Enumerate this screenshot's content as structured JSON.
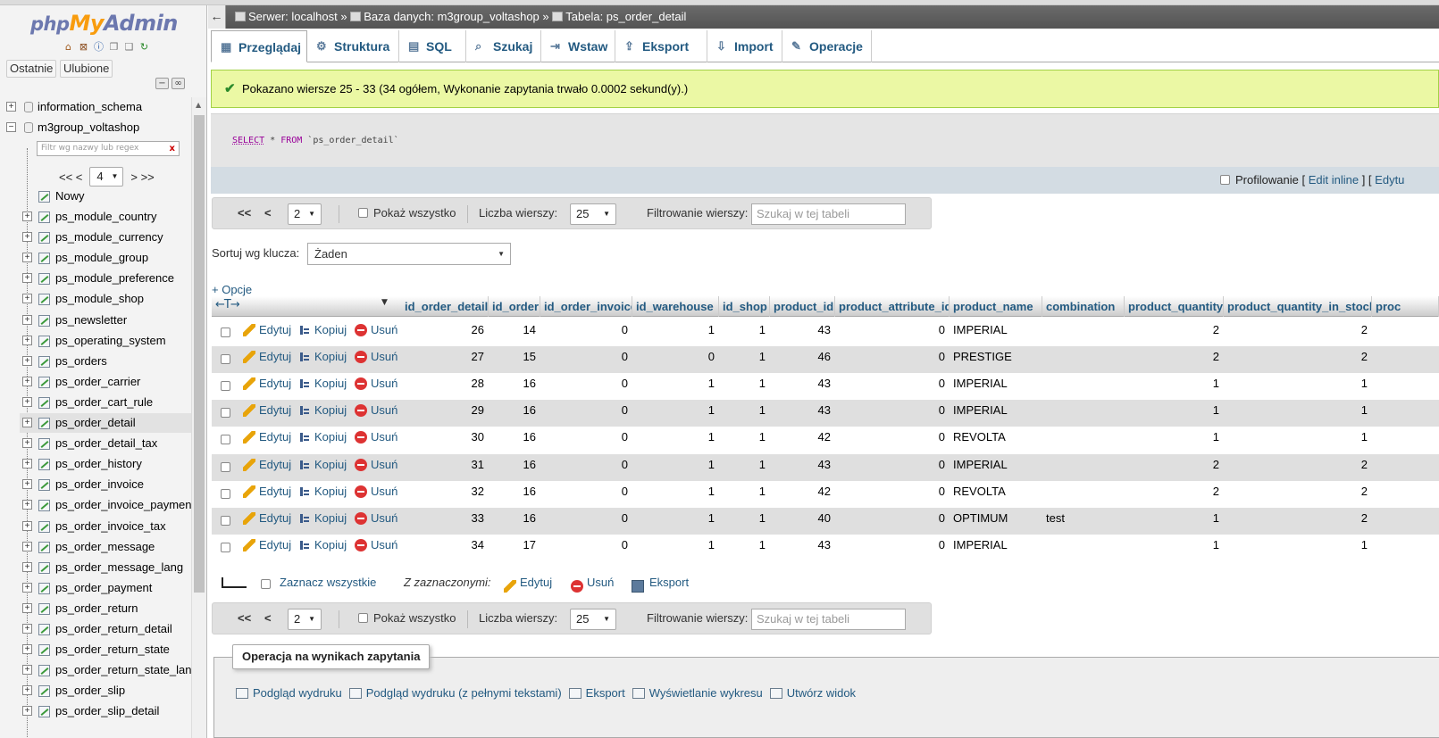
{
  "nav": {
    "logo_php": "php",
    "logo_my": "My",
    "logo_admin": "Admin",
    "recent_tab": "Ostatnie",
    "favorites_tab": "Ulubione",
    "filter_placeholder": "Filtr wg nazwy lub regex",
    "filter_clear": "x",
    "pager_first": "<< <",
    "pager_value": "4",
    "pager_next": "> >>",
    "databases": [
      {
        "name": "information_schema",
        "expander": "+"
      },
      {
        "name": "m3group_voltashop",
        "expander": "−"
      }
    ],
    "new_label": "Nowy",
    "tables": [
      "ps_module_country",
      "ps_module_currency",
      "ps_module_group",
      "ps_module_preference",
      "ps_module_shop",
      "ps_newsletter",
      "ps_operating_system",
      "ps_orders",
      "ps_order_carrier",
      "ps_order_cart_rule",
      "ps_order_detail",
      "ps_order_detail_tax",
      "ps_order_history",
      "ps_order_invoice",
      "ps_order_invoice_payment",
      "ps_order_invoice_tax",
      "ps_order_message",
      "ps_order_message_lang",
      "ps_order_payment",
      "ps_order_return",
      "ps_order_return_detail",
      "ps_order_return_state",
      "ps_order_return_state_lang",
      "ps_order_slip",
      "ps_order_slip_detail"
    ],
    "highlighted_table": "ps_order_detail"
  },
  "breadcrumb": {
    "server": "Serwer: localhost",
    "sep1": "»",
    "database": "Baza danych: m3group_voltashop",
    "sep2": "»",
    "table": "Tabela: ps_order_detail",
    "back": "←"
  },
  "tabs": [
    {
      "label": "Przeglądaj",
      "icon": "browse-icon"
    },
    {
      "label": "Struktura",
      "icon": "structure-icon"
    },
    {
      "label": "SQL",
      "icon": "sql-icon"
    },
    {
      "label": "Szukaj",
      "icon": "search-icon"
    },
    {
      "label": "Wstaw",
      "icon": "insert-icon"
    },
    {
      "label": "Eksport",
      "icon": "export-icon"
    },
    {
      "label": "Import",
      "icon": "import-icon"
    },
    {
      "label": "Operacje",
      "icon": "operations-icon"
    }
  ],
  "notice": "Pokazano wiersze 25 - 33 (34 ogółem, Wykonanie zapytania trwało 0.0002 sekund(y).)",
  "sql": {
    "kw1": "SELECT",
    "rest1": " * ",
    "kw2": "FROM",
    "rest2": " `ps_order_detail`"
  },
  "profile": {
    "label": "Profilowanie",
    "open": "[",
    "edit_inline": "Edit inline",
    "close": "] [",
    "edit": "Edytu"
  },
  "pagination": {
    "first": "<<",
    "prev": "<",
    "page": "2",
    "show_all": "Pokaż wszystko",
    "rows_label": "Liczba wierszy:",
    "rows_value": "25",
    "filter_label": "Filtrowanie wierszy:",
    "filter_placeholder": "Szukaj w tej tabeli"
  },
  "sort": {
    "label": "Sortuj wg klucza:",
    "value": "Żaden"
  },
  "options_link": "+ Opcje",
  "column_resize_arrows": "←T→",
  "columns": [
    "id_order_detail",
    "id_order",
    "id_order_invoice",
    "id_warehouse",
    "id_shop",
    "product_id",
    "product_attribute_id",
    "product_name",
    "combination",
    "product_quantity",
    "product_quantity_in_stock",
    "proc"
  ],
  "row_actions": {
    "edit": "Edytuj",
    "copy": "Kopiuj",
    "delete": "Usuń"
  },
  "rows": [
    {
      "id_order_detail": "26",
      "id_order": "14",
      "id_order_invoice": "0",
      "id_warehouse": "1",
      "id_shop": "1",
      "product_id": "43",
      "product_attribute_id": "0",
      "product_name": "IMPERIAL",
      "combination": "",
      "product_quantity": "2",
      "product_quantity_in_stock": "2"
    },
    {
      "id_order_detail": "27",
      "id_order": "15",
      "id_order_invoice": "0",
      "id_warehouse": "0",
      "id_shop": "1",
      "product_id": "46",
      "product_attribute_id": "0",
      "product_name": "PRESTIGE",
      "combination": "",
      "product_quantity": "2",
      "product_quantity_in_stock": "2"
    },
    {
      "id_order_detail": "28",
      "id_order": "16",
      "id_order_invoice": "0",
      "id_warehouse": "1",
      "id_shop": "1",
      "product_id": "43",
      "product_attribute_id": "0",
      "product_name": "IMPERIAL",
      "combination": "",
      "product_quantity": "1",
      "product_quantity_in_stock": "1"
    },
    {
      "id_order_detail": "29",
      "id_order": "16",
      "id_order_invoice": "0",
      "id_warehouse": "1",
      "id_shop": "1",
      "product_id": "43",
      "product_attribute_id": "0",
      "product_name": "IMPERIAL",
      "combination": "",
      "product_quantity": "1",
      "product_quantity_in_stock": "1"
    },
    {
      "id_order_detail": "30",
      "id_order": "16",
      "id_order_invoice": "0",
      "id_warehouse": "1",
      "id_shop": "1",
      "product_id": "42",
      "product_attribute_id": "0",
      "product_name": "REVOLTA",
      "combination": "",
      "product_quantity": "1",
      "product_quantity_in_stock": "1"
    },
    {
      "id_order_detail": "31",
      "id_order": "16",
      "id_order_invoice": "0",
      "id_warehouse": "1",
      "id_shop": "1",
      "product_id": "43",
      "product_attribute_id": "0",
      "product_name": "IMPERIAL",
      "combination": "",
      "product_quantity": "2",
      "product_quantity_in_stock": "2"
    },
    {
      "id_order_detail": "32",
      "id_order": "16",
      "id_order_invoice": "0",
      "id_warehouse": "1",
      "id_shop": "1",
      "product_id": "42",
      "product_attribute_id": "0",
      "product_name": "REVOLTA",
      "combination": "",
      "product_quantity": "2",
      "product_quantity_in_stock": "2"
    },
    {
      "id_order_detail": "33",
      "id_order": "16",
      "id_order_invoice": "0",
      "id_warehouse": "1",
      "id_shop": "1",
      "product_id": "40",
      "product_attribute_id": "0",
      "product_name": "OPTIMUM",
      "combination": "test",
      "product_quantity": "1",
      "product_quantity_in_stock": "2"
    },
    {
      "id_order_detail": "34",
      "id_order": "17",
      "id_order_invoice": "0",
      "id_warehouse": "1",
      "id_shop": "1",
      "product_id": "43",
      "product_attribute_id": "0",
      "product_name": "IMPERIAL",
      "combination": "",
      "product_quantity": "1",
      "product_quantity_in_stock": "1"
    }
  ],
  "bulk": {
    "select_all": "Zaznacz wszystkie",
    "with_selected": "Z zaznaczonymi:",
    "edit": "Edytuj",
    "delete": "Usuń",
    "export": "Eksport"
  },
  "query_ops": {
    "legend": "Operacja na wynikach zapytania",
    "items": [
      "Podgląd wydruku",
      "Podgląd wydruku (z pełnymi tekstami)",
      "Eksport",
      "Wyświetlanie wykresu",
      "Utwórz widok"
    ]
  },
  "colors": {
    "link": "#235a81",
    "notice_bg": "#ebf8a4",
    "notice_border": "#a2d246",
    "row_alt": "#dfdfdf",
    "logo_orange": "#f89c0e",
    "logo_blue": "#6c78af"
  }
}
